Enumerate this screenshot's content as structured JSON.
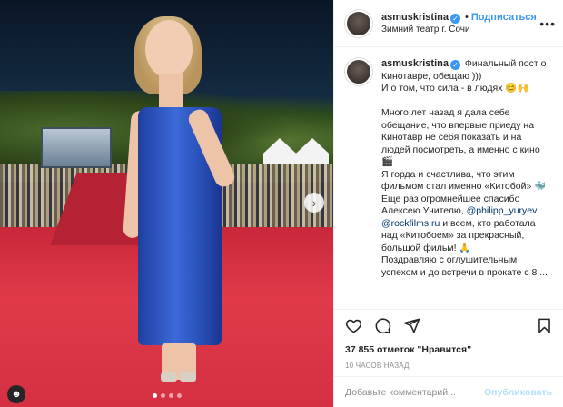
{
  "post": {
    "author": {
      "username": "asmuskristina",
      "verified": true,
      "follow_label": "Подписаться",
      "location": "Зимний театр г. Сочи"
    },
    "more_icon": "ellipsis-icon",
    "caption": {
      "username": "asmuskristina",
      "paragraphs": [
        "Финальный пост о Кинотавре, обещаю )))",
        "И о том, что сила - в людях 😊🙌",
        "Много лет назад я дала себе обещание, что впервые приеду на Кинотавр не себя показать и на людей посмотреть, а именно с кино 🎬",
        "Я горда и счастлива, что этим фильмом стал именно «Китобой» 🐳",
        "Еще раз огромнейшее спасибо Алексею Учителю,",
        "@philipp_yuryev",
        "@rockfilms.ru",
        "и всем, кто работала над «Китобоем» за прекрасный, большой фильм! 🙏",
        "Поздравляю с оглушительным успехом и до встречи в прокате с 8 ..."
      ]
    },
    "likes_text": "37 855 отметок \"Нравится\"",
    "time_text": "10 ЧАСОВ НАЗАД",
    "comment_placeholder": "Добавьте комментарий...",
    "publish_label": "Опубликовать"
  },
  "colors": {
    "link": "#3897f0",
    "publish_disabled": "#b2dffc",
    "dress": "#2f5bc9",
    "carpet": "#d8323f"
  },
  "carousel": {
    "total": 4,
    "active": 1
  }
}
